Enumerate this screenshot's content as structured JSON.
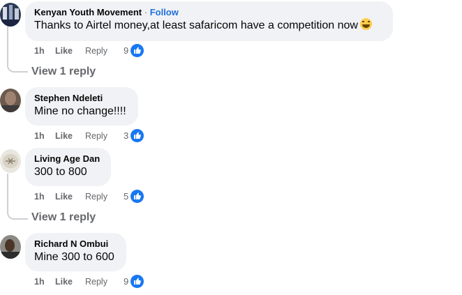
{
  "comments": [
    {
      "author": "Kenyan Youth Movement",
      "follow_label": "Follow",
      "separator": "·",
      "text": "Thanks to Airtel money,at least safaricom have a competition now",
      "time": "1h",
      "like": "Like",
      "reply": "Reply",
      "reaction_count": "9",
      "view_replies": "View 1 reply"
    },
    {
      "author": "Stephen Ndeleti",
      "text": "Mine no change!!!!",
      "time": "1h",
      "like": "Like",
      "reply": "Reply",
      "reaction_count": "3"
    },
    {
      "author": "Living Age Dan",
      "text": "300 to 800",
      "time": "1h",
      "like": "Like",
      "reply": "Reply",
      "reaction_count": "5",
      "view_replies": "View 1 reply"
    },
    {
      "author": "Richard N Ombui",
      "text": "Mine 300 to 600",
      "time": "1h",
      "like": "Like",
      "reply": "Reply",
      "reaction_count": "9"
    }
  ],
  "colors": {
    "bubble": "#f0f2f5",
    "link_blue": "#216fdb",
    "meta_gray": "#65676b",
    "like_blue": "#1877f2"
  },
  "icons": {
    "reaction": "thumbs-up-icon",
    "emoji": "laughing-emoji-icon"
  }
}
